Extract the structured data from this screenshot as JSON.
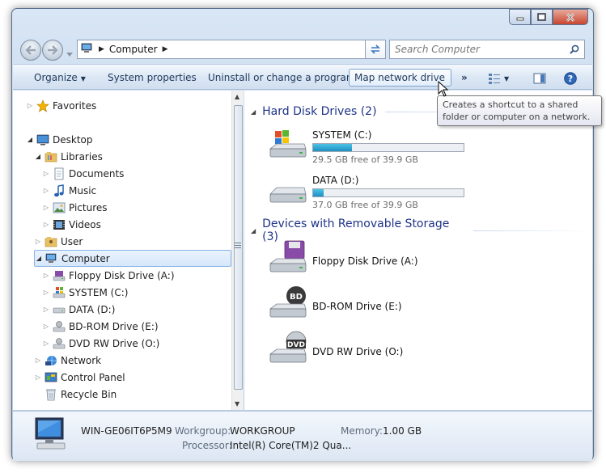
{
  "address": {
    "crumbs": [
      "Computer"
    ],
    "search_placeholder": "Search Computer"
  },
  "toolbar": {
    "organize": "Organize",
    "system_properties": "System properties",
    "uninstall": "Uninstall or change a program",
    "map_network_drive": "Map network drive",
    "more": "»"
  },
  "tooltip": "Creates a shortcut to a shared folder or computer on a network.",
  "nav": {
    "favorites": "Favorites",
    "desktop": "Desktop",
    "libraries": "Libraries",
    "documents": "Documents",
    "music": "Music",
    "pictures": "Pictures",
    "videos": "Videos",
    "user": "User",
    "computer": "Computer",
    "floppy": "Floppy Disk Drive (A:)",
    "system": "SYSTEM (C:)",
    "data": "DATA (D:)",
    "bdrom": "BD-ROM Drive (E:)",
    "dvdrw": "DVD RW Drive (O:)",
    "network": "Network",
    "control_panel": "Control Panel",
    "recycle_bin": "Recycle Bin"
  },
  "content": {
    "hdd_header": "Hard Disk Drives (2)",
    "drives": [
      {
        "name": "SYSTEM (C:)",
        "free": "29.5 GB free of 39.9 GB",
        "used_fraction": 0.26
      },
      {
        "name": "DATA (D:)",
        "free": "37.0 GB free of 39.9 GB",
        "used_fraction": 0.07
      }
    ],
    "removable_header": "Devices with Removable Storage (3)",
    "removable": [
      {
        "name": "Floppy Disk Drive (A:)"
      },
      {
        "name": "BD-ROM Drive (E:)"
      },
      {
        "name": "DVD RW Drive (O:)"
      }
    ]
  },
  "details": {
    "computer_name": "WIN-GE06IT6P5M9",
    "workgroup_label": "Workgroup:",
    "workgroup": "WORKGROUP",
    "memory_label": "Memory:",
    "memory": "1.00 GB",
    "processor_label": "Processor:",
    "processor": "Intel(R) Core(TM)2 Qua..."
  },
  "colors": {
    "header_blue": "#1e3287",
    "bar_fill": "#1e8fc2",
    "selection": "#d5e7fb"
  },
  "icons": [
    "back-arrow-icon",
    "forward-arrow-icon",
    "computer-icon",
    "refresh-icon",
    "search-icon",
    "views-icon",
    "preview-pane-icon",
    "help-icon",
    "star-icon",
    "folder-icon",
    "drive-icon",
    "floppy-icon",
    "optical-drive-icon",
    "network-icon",
    "recycle-bin-icon"
  ]
}
